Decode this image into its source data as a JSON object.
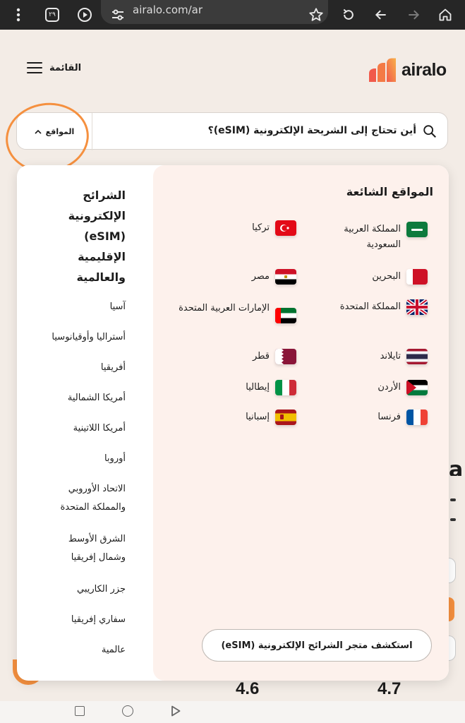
{
  "browser": {
    "tab_count": "٢٩",
    "url": "airalo.com/ar"
  },
  "header": {
    "menu_label": "القائمة",
    "logo_text": "airalo"
  },
  "search": {
    "destinations_label": "المواقع",
    "placeholder": "أين تحتاج إلى الشريحة الإلكترونية (eSIM)؟"
  },
  "popular": {
    "title": "المواقع الشائعة",
    "countries": [
      {
        "name": "المملكة العربية السعودية",
        "flag": "saudi-arabia"
      },
      {
        "name": "تركيا",
        "flag": "turkey"
      },
      {
        "name": "البحرين",
        "flag": "bahrain"
      },
      {
        "name": "مصر",
        "flag": "egypt"
      },
      {
        "name": "المملكة المتحدة",
        "flag": "united-kingdom"
      },
      {
        "name": "الإمارات العربية المتحدة",
        "flag": "uae"
      },
      {
        "name": "تايلاند",
        "flag": "thailand"
      },
      {
        "name": "قطر",
        "flag": "qatar"
      },
      {
        "name": "الأردن",
        "flag": "jordan"
      },
      {
        "name": "إيطاليا",
        "flag": "italy"
      },
      {
        "name": "فرنسا",
        "flag": "france"
      },
      {
        "name": "إسبانيا",
        "flag": "spain"
      }
    ],
    "explore_label": "استكشف متجر الشرائح الإلكترونية (eSIM)"
  },
  "regions": {
    "title": "الشرائح الإلكترونية (eSIM) الإقليمية والعالمية",
    "items": [
      "آسيا",
      "أستراليا وأوقيانوسيا",
      "أفريقيا",
      "أمريكا الشمالية",
      "أمريكا اللاتينية",
      "أوروبا",
      "الاتحاد الأوروبي والمملكة المتحدة",
      "الشرق الأوسط وشمال إفريقيا",
      "جزر الكاريبي",
      "سفاري إفريقيا",
      "عالمية"
    ]
  },
  "background": {
    "rating_left": "4.6",
    "rating_right": "4.7"
  },
  "colors": {
    "accent": "#f5903f",
    "panel_tint": "#fdf1ec",
    "page_bg": "#f3ece6"
  }
}
